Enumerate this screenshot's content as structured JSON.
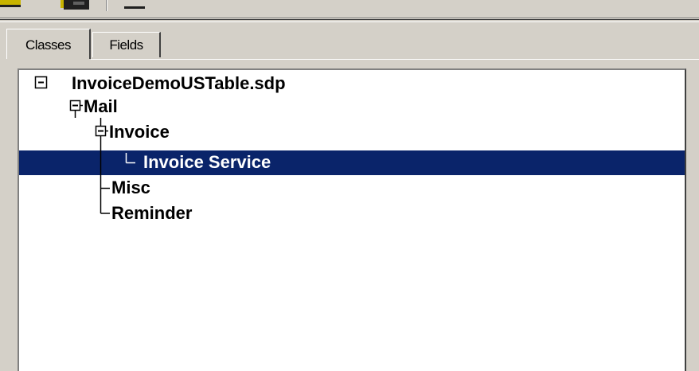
{
  "tabs": [
    {
      "label": "Classes",
      "active": true
    },
    {
      "label": "Fields",
      "active": false
    }
  ],
  "tree": {
    "root": "InvoiceDemoUSTable.sdp",
    "mail": "Mail",
    "invoice": "Invoice",
    "invoice_service": "Invoice Service",
    "misc": "Misc",
    "reminder": "Reminder",
    "selected": "Invoice Service"
  },
  "colors": {
    "selection": "#0a246a",
    "window_bg": "#d4d0c8",
    "tree_bg": "#ffffff"
  },
  "icons": [
    "toolbar-folder-icon",
    "toolbar-printer-icon",
    "toolbar-button-icon",
    "collapse-minus-icon"
  ]
}
